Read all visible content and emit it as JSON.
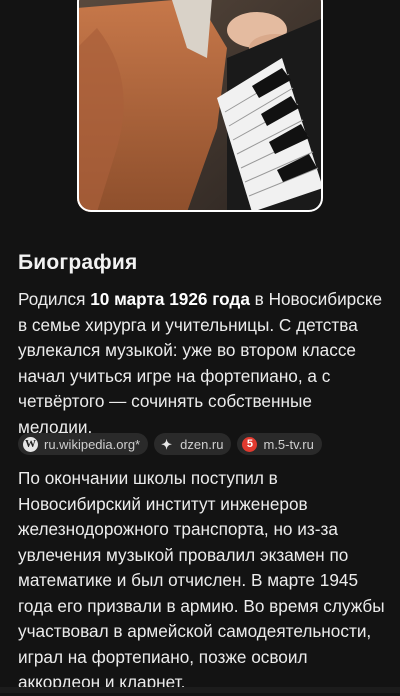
{
  "photo": {
    "alt_icon": "portrait-photo-pianist"
  },
  "biography": {
    "heading": "Биография",
    "para1": {
      "pre": "Родился ",
      "bold": "10 марта 1926 года",
      "post": " в Новосибирске в семье хирурга и учительницы. С детства увлекался музыкой: уже во втором классе начал учиться игре на фортепиано, а с четвёртого — сочинять собственные мелодии."
    },
    "sources": [
      {
        "label": "ru.wikipedia.org*",
        "icon": "wikipedia-icon"
      },
      {
        "label": "dzen.ru",
        "icon": "dzen-icon"
      },
      {
        "label": "m.5-tv.ru",
        "icon": "channel5-icon"
      }
    ],
    "para2": "По окончании школы поступил в Новосибирский институт инженеров железнодорожного транспорта, но из-за увлечения музыкой провалил экзамен по математике и был отчислен. В марте 1945 года его призвали в армию. Во время службы участвовал в армейской самодеятельности, играл на фортепиано, позже освоил аккордеон и кларнет."
  },
  "colors": {
    "background": "#131313",
    "chip_bg": "#2a2a2a",
    "channel5_red": "#e03a2f"
  }
}
